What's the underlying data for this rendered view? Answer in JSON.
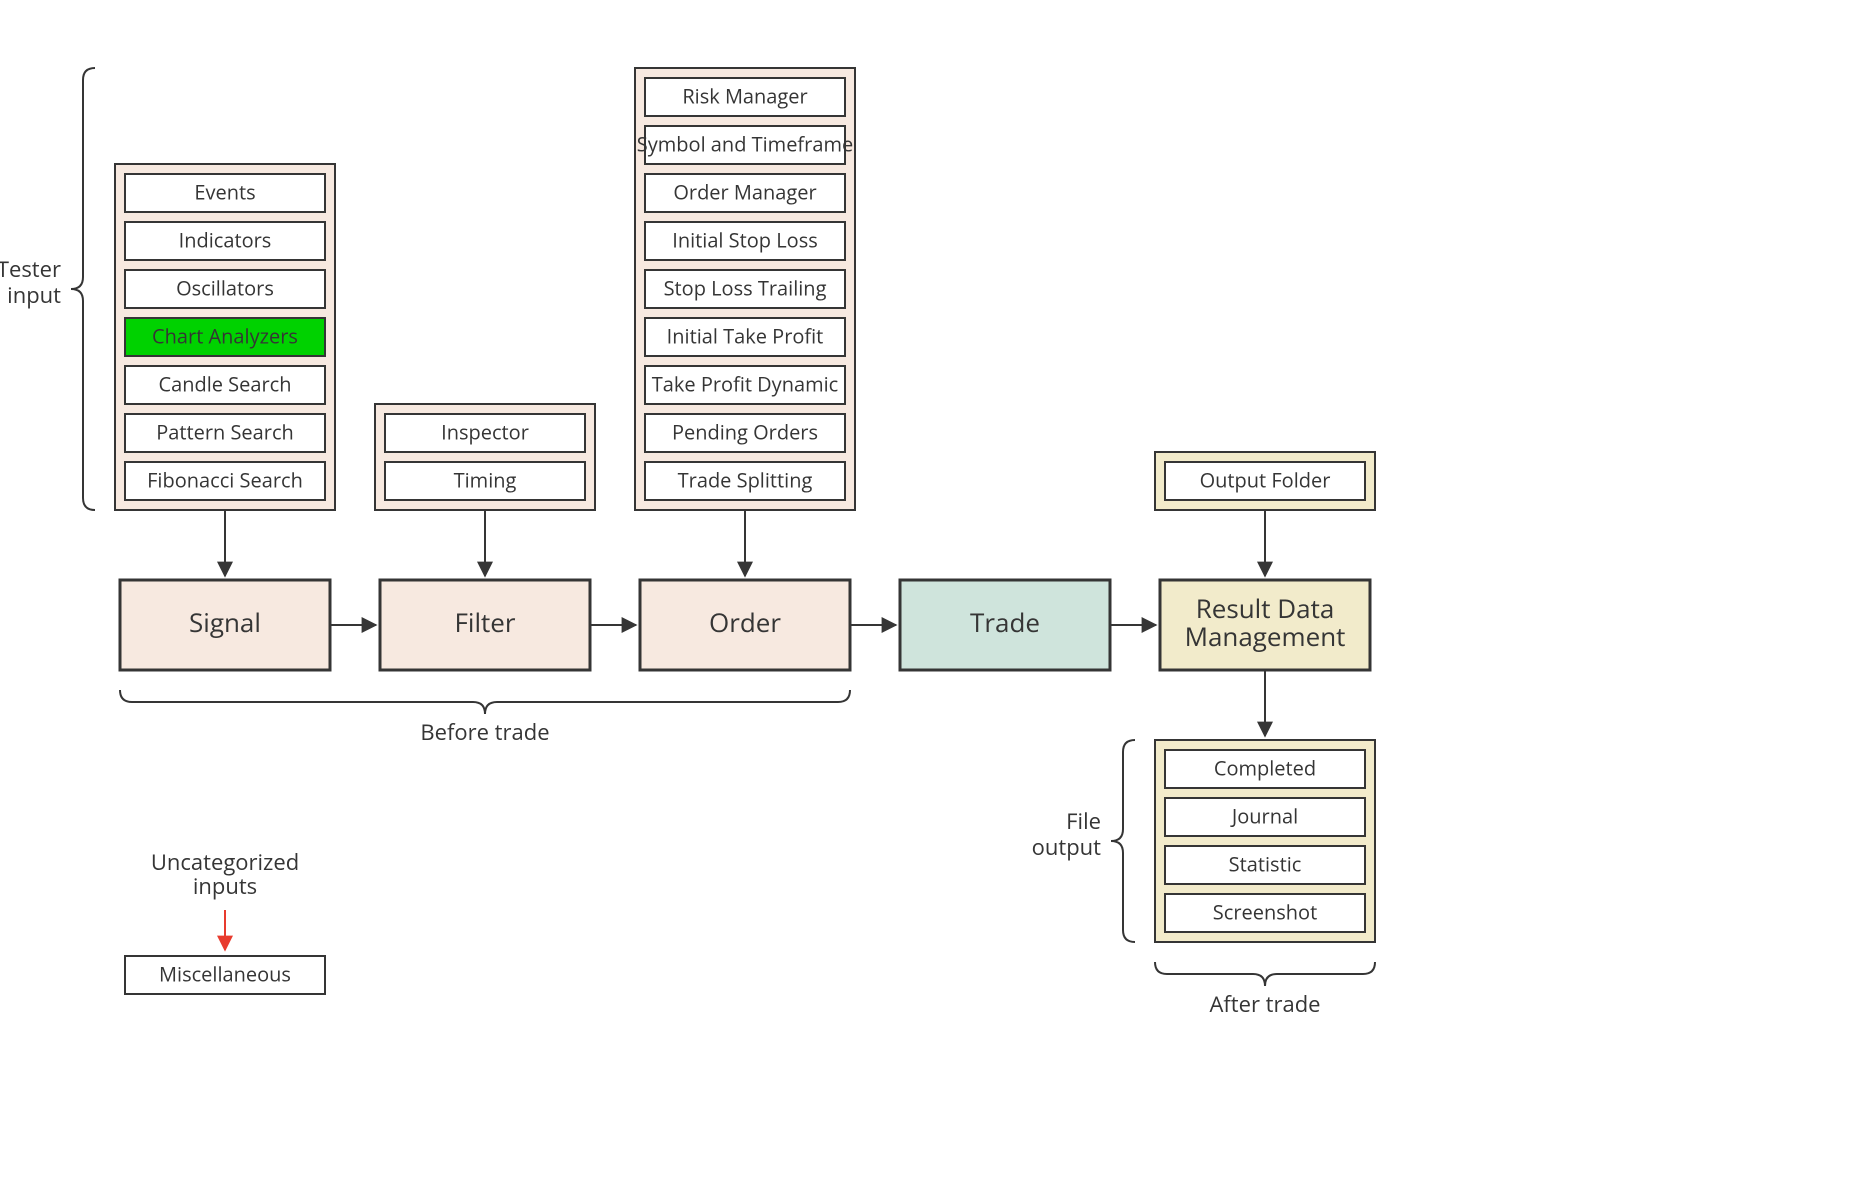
{
  "labels": {
    "tester_input_line1": "Tester",
    "tester_input_line2": "input",
    "before_trade": "Before trade",
    "after_trade": "After trade",
    "file_output_line1": "File",
    "file_output_line2": "output",
    "uncategorized_line1": "Uncategorized",
    "uncategorized_line2": "inputs",
    "misc": "Miscellaneous"
  },
  "stages": {
    "signal": "Signal",
    "filter": "Filter",
    "order": "Order",
    "trade": "Trade",
    "result_line1": "Result Data",
    "result_line2": "Management"
  },
  "groups": {
    "signal": [
      {
        "label": "Events",
        "highlight": false
      },
      {
        "label": "Indicators",
        "highlight": false
      },
      {
        "label": "Oscillators",
        "highlight": false
      },
      {
        "label": "Chart Analyzers",
        "highlight": true
      },
      {
        "label": "Candle Search",
        "highlight": false
      },
      {
        "label": "Pattern Search",
        "highlight": false
      },
      {
        "label": "Fibonacci Search",
        "highlight": false
      }
    ],
    "filter": [
      {
        "label": "Inspector",
        "highlight": false
      },
      {
        "label": "Timing",
        "highlight": false
      }
    ],
    "order": [
      {
        "label": "Risk Manager",
        "highlight": false
      },
      {
        "label": "Symbol and Timeframe",
        "highlight": false
      },
      {
        "label": "Order Manager",
        "highlight": false
      },
      {
        "label": "Initial Stop Loss",
        "highlight": false
      },
      {
        "label": "Stop Loss Trailing",
        "highlight": false
      },
      {
        "label": "Initial Take Profit",
        "highlight": false
      },
      {
        "label": "Take Profit Dynamic",
        "highlight": false
      },
      {
        "label": "Pending Orders",
        "highlight": false
      },
      {
        "label": "Trade Splitting",
        "highlight": false
      }
    ],
    "result_in": [
      {
        "label": "Output Folder",
        "highlight": false
      }
    ],
    "result_out": [
      {
        "label": "Completed",
        "highlight": false
      },
      {
        "label": "Journal",
        "highlight": false
      },
      {
        "label": "Statistic",
        "highlight": false
      },
      {
        "label": "Screenshot",
        "highlight": false
      }
    ]
  }
}
